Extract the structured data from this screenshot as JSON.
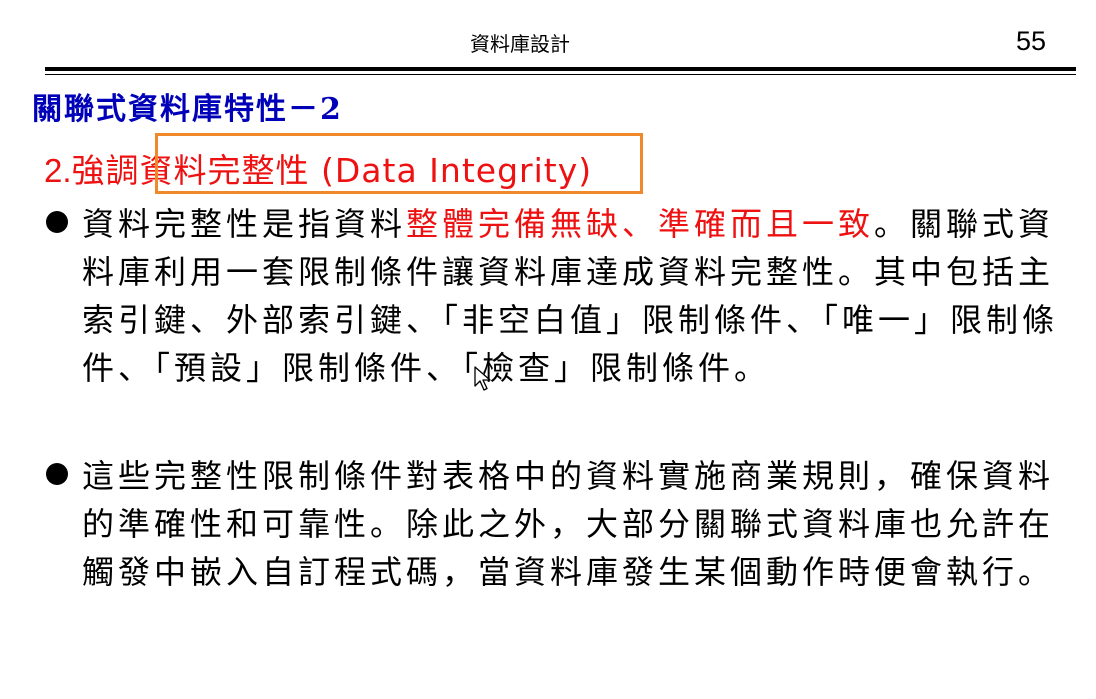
{
  "header": {
    "title": "資料庫設計",
    "page_number": "55"
  },
  "slide": {
    "title": "關聯式資料庫特性－2",
    "subheading": {
      "number": "2.",
      "prefix": "強調",
      "highlighted": "資料完整性 (Data Integrity)"
    },
    "bullets": [
      {
        "segments": [
          {
            "text": "資料完整性是指資料",
            "color": "#000000"
          },
          {
            "text": "整體完備無缺、準確而且一致",
            "color": "#ee1111"
          },
          {
            "text": "。關聯式資料庫利用一套限制條件讓資料庫達成資料完整性。其中包括主索引鍵、外部索引鍵、「非空白值」限制條件、「唯一」限制條件、「預設」限制條件、「檢查」限制條件。",
            "color": "#000000"
          }
        ]
      },
      {
        "segments": [
          {
            "text": "這些完整性限制條件對表格中的資料實施商業規則，確保資料的準確性和可靠性。除此之外，大部分關聯式資料庫也允許在觸發中嵌入自訂程式碼，當資料庫發生某個動作時便會執行。",
            "color": "#000000"
          }
        ]
      }
    ]
  },
  "colors": {
    "title": "#0000b8",
    "accent_red": "#ee1111",
    "highlight_border": "#f0892a"
  },
  "icons": {
    "cursor": "mouse-pointer-icon"
  }
}
